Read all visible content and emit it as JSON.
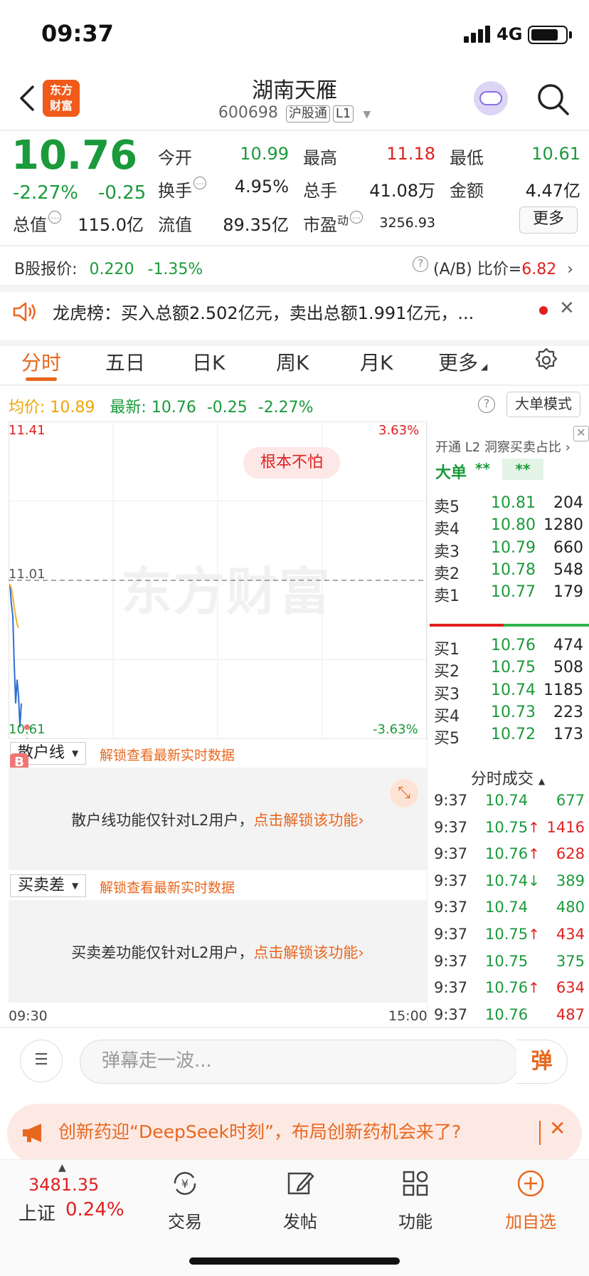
{
  "status_bar": {
    "time": "09:37",
    "network": "4G"
  },
  "header": {
    "logo_line1": "东方",
    "logo_line2": "财富",
    "stock_name": "湖南天雁",
    "stock_code": "600698",
    "tag_connect": "沪股通",
    "tag_level": "L1"
  },
  "quote": {
    "price": "10.76",
    "change_pct": "-2.27%",
    "change": "-0.25",
    "open_label": "今开",
    "open": "10.99",
    "high_label": "最高",
    "high": "11.18",
    "low_label": "最低",
    "low": "10.61",
    "turnover_label": "换手",
    "turnover": "4.95%",
    "volume_label": "总手",
    "volume": "41.08万",
    "amount_label": "金额",
    "amount": "4.47亿",
    "mktcap_label": "总值",
    "mktcap": "115.0亿",
    "float_label": "流值",
    "float_cap": "89.35亿",
    "pe_label": "市盈",
    "pe_super": "动",
    "pe": "3256.93",
    "more_label": "更多"
  },
  "b_share": {
    "label": "B股报价:",
    "price": "0.220",
    "change_pct": "-1.35%",
    "ratio_label": "(A/B) 比价=",
    "ratio": "6.82"
  },
  "dragon_tiger": {
    "text": "龙虎榜：买入总额2.502亿元，卖出总额1.991亿元，..."
  },
  "tabs": [
    {
      "label": "分时"
    },
    {
      "label": "五日"
    },
    {
      "label": "日K"
    },
    {
      "label": "周K"
    },
    {
      "label": "月K"
    },
    {
      "label": "更多"
    }
  ],
  "avg_row": {
    "avg_label": "均价:",
    "avg": "10.89",
    "latest_label": "最新:",
    "latest": "10.76",
    "change": "-0.25",
    "change_pct": "-2.27%",
    "big_order_mode": "大单模式"
  },
  "chart": {
    "y_top": "11.41",
    "y_mid": "11.01",
    "y_bottom": "10.61",
    "pct_top": "3.63%",
    "pct_bottom": "-3.63%",
    "watermark": "东方财富",
    "pill": "根本不怕",
    "time_start": "09:30",
    "time_end": "15:00"
  },
  "chart_data": {
    "type": "line",
    "ylim": [
      10.61,
      11.41
    ],
    "reference": 11.01,
    "series": [
      {
        "values": [
          11.0,
          10.95,
          10.92,
          10.8,
          10.7,
          10.76,
          10.72,
          10.64,
          10.7
        ]
      },
      {
        "values": [
          11.0,
          10.99,
          10.97,
          10.94,
          10.92,
          10.9,
          10.89
        ]
      }
    ],
    "colors": [
      "#2f6fd6",
      "#f0b429"
    ]
  },
  "sub_panels": {
    "retail": {
      "dropdown": "散户线",
      "unlock_title": "解锁查看最新实时数据",
      "text": "散户线功能仅针对L2用户，",
      "link": "点击解锁该功能"
    },
    "spread": {
      "dropdown": "买卖差",
      "unlock_title": "解锁查看最新实时数据",
      "text": "买卖差功能仅针对L2用户，",
      "link": "点击解锁该功能"
    },
    "b_badge": "B"
  },
  "order_book": {
    "l2_title": "开通 L2 洞察买卖占比",
    "big_label": "大单",
    "stars1": "**",
    "stars2": "**",
    "asks": [
      {
        "label": "卖5",
        "price": "10.81",
        "vol": "204"
      },
      {
        "label": "卖4",
        "price": "10.80",
        "vol": "1280"
      },
      {
        "label": "卖3",
        "price": "10.79",
        "vol": "660"
      },
      {
        "label": "卖2",
        "price": "10.78",
        "vol": "548"
      },
      {
        "label": "卖1",
        "price": "10.77",
        "vol": "179"
      }
    ],
    "bids": [
      {
        "label": "买1",
        "price": "10.76",
        "vol": "474"
      },
      {
        "label": "买2",
        "price": "10.75",
        "vol": "508"
      },
      {
        "label": "买3",
        "price": "10.74",
        "vol": "1185"
      },
      {
        "label": "买4",
        "price": "10.73",
        "vol": "223"
      },
      {
        "label": "买5",
        "price": "10.72",
        "vol": "173"
      }
    ]
  },
  "trades": {
    "title": "分时成交",
    "rows": [
      {
        "time": "9:37",
        "price": "10.74",
        "arrow": "",
        "vol": "677",
        "side": "buy"
      },
      {
        "time": "9:37",
        "price": "10.75",
        "arrow": "↑",
        "vol": "1416",
        "side": "sell"
      },
      {
        "time": "9:37",
        "price": "10.76",
        "arrow": "↑",
        "vol": "628",
        "side": "sell"
      },
      {
        "time": "9:37",
        "price": "10.74",
        "arrow": "↓",
        "vol": "389",
        "side": "buy"
      },
      {
        "time": "9:37",
        "price": "10.74",
        "arrow": "",
        "vol": "480",
        "side": "buy"
      },
      {
        "time": "9:37",
        "price": "10.75",
        "arrow": "↑",
        "vol": "434",
        "side": "sell"
      },
      {
        "time": "9:37",
        "price": "10.75",
        "arrow": "",
        "vol": "375",
        "side": "buy"
      },
      {
        "time": "9:37",
        "price": "10.76",
        "arrow": "↑",
        "vol": "634",
        "side": "sell"
      },
      {
        "time": "9:37",
        "price": "10.76",
        "arrow": "",
        "vol": "487",
        "side": "sell"
      }
    ]
  },
  "comment": {
    "placeholder": "弹幕走一波...",
    "danmu_label": "弹"
  },
  "banner": {
    "text": "创新药迎“DeepSeek时刻”，布局创新药机会来了?"
  },
  "bottom_nav": {
    "index_value": "3481.35",
    "index_name": "上证",
    "index_change": "0.24%",
    "items": [
      {
        "label": "交易"
      },
      {
        "label": "发帖"
      },
      {
        "label": "功能"
      },
      {
        "label": "加自选"
      }
    ]
  }
}
